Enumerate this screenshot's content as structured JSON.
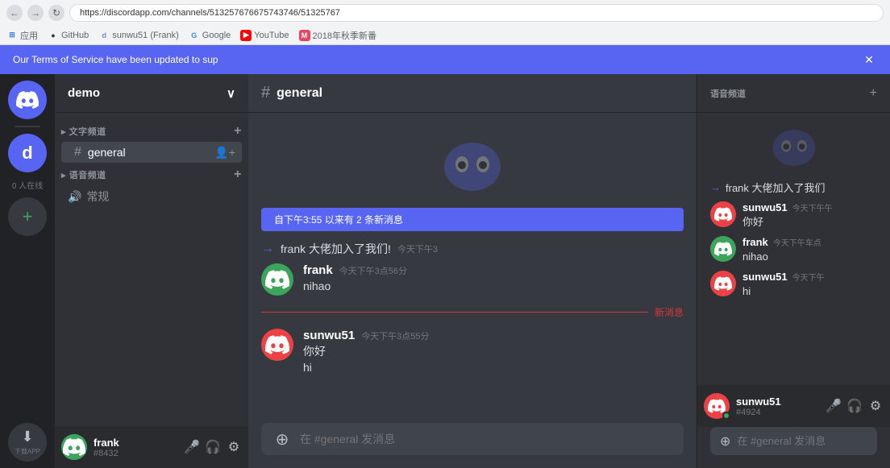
{
  "browser": {
    "address": "https://discordapp.com/channels/513257676675743746/51325767",
    "bookmarks": [
      {
        "label": "应用",
        "icon": "⊞",
        "class": "bm-apps"
      },
      {
        "label": "GitHub",
        "icon": "🐙",
        "class": "bm-github"
      },
      {
        "label": "sunwu51 (Frank)",
        "icon": "d",
        "class": "bm-discord"
      },
      {
        "label": "Google",
        "icon": "G",
        "class": "bm-google"
      },
      {
        "label": "YouTube",
        "icon": "▶",
        "class": "bm-youtube"
      },
      {
        "label": "2018年秋季新番",
        "icon": "M",
        "class": "bm-2018"
      }
    ],
    "notification": "Our Terms of Service have been updated to sup"
  },
  "server": {
    "name": "demo",
    "text_category": "文字频道",
    "voice_category": "语音频道",
    "channels": [
      {
        "name": "general",
        "type": "text",
        "active": true
      }
    ],
    "voice_channels": [
      {
        "name": "常规",
        "type": "voice"
      }
    ]
  },
  "chat": {
    "channel": "general",
    "new_messages_bar": "自下午3:55 以来有 2 条新消息",
    "system_message": {
      "text": "frank 大佬加入了我们!",
      "time": "今天下午3"
    },
    "messages": [
      {
        "author": "frank",
        "avatar_color": "green",
        "time": "今天下午3点56分",
        "text": "nihao",
        "text2": ""
      },
      {
        "author": "sunwu51",
        "avatar_color": "red",
        "time": "今天下午3点55分",
        "text": "你好",
        "text2": "hi"
      }
    ],
    "divider_label": "新消息",
    "input_placeholder": "在 #general 发消息"
  },
  "user": {
    "name": "frank",
    "discriminator": "#8432",
    "controls": [
      "🎤",
      "🎧",
      "⚙"
    ]
  },
  "right_panel": {
    "voice_section": "语音频道",
    "add_icon": "+",
    "system_message": "frank 大佬加入了我们",
    "messages": [
      {
        "author": "sunwu51",
        "avatar_color": "red",
        "time": "今天下午午",
        "text": "你好"
      },
      {
        "author": "frank",
        "avatar_color": "green",
        "time": "今天下午车点",
        "text": "nihao"
      },
      {
        "author": "sunwu51",
        "avatar_color": "red",
        "time": "今天下午",
        "text": "hi"
      }
    ],
    "user": {
      "name": "sunwu51",
      "discriminator": "#4924"
    },
    "input_placeholder": "在 #general 发消息"
  },
  "icons": {
    "discord": "🎮",
    "hash": "#",
    "voice": "🔊",
    "plus": "+",
    "down_arrow": "∨",
    "arrow_right": "→",
    "mic": "🎤",
    "headphones": "🎧",
    "settings": "⚙",
    "add_plus": "⊕"
  }
}
